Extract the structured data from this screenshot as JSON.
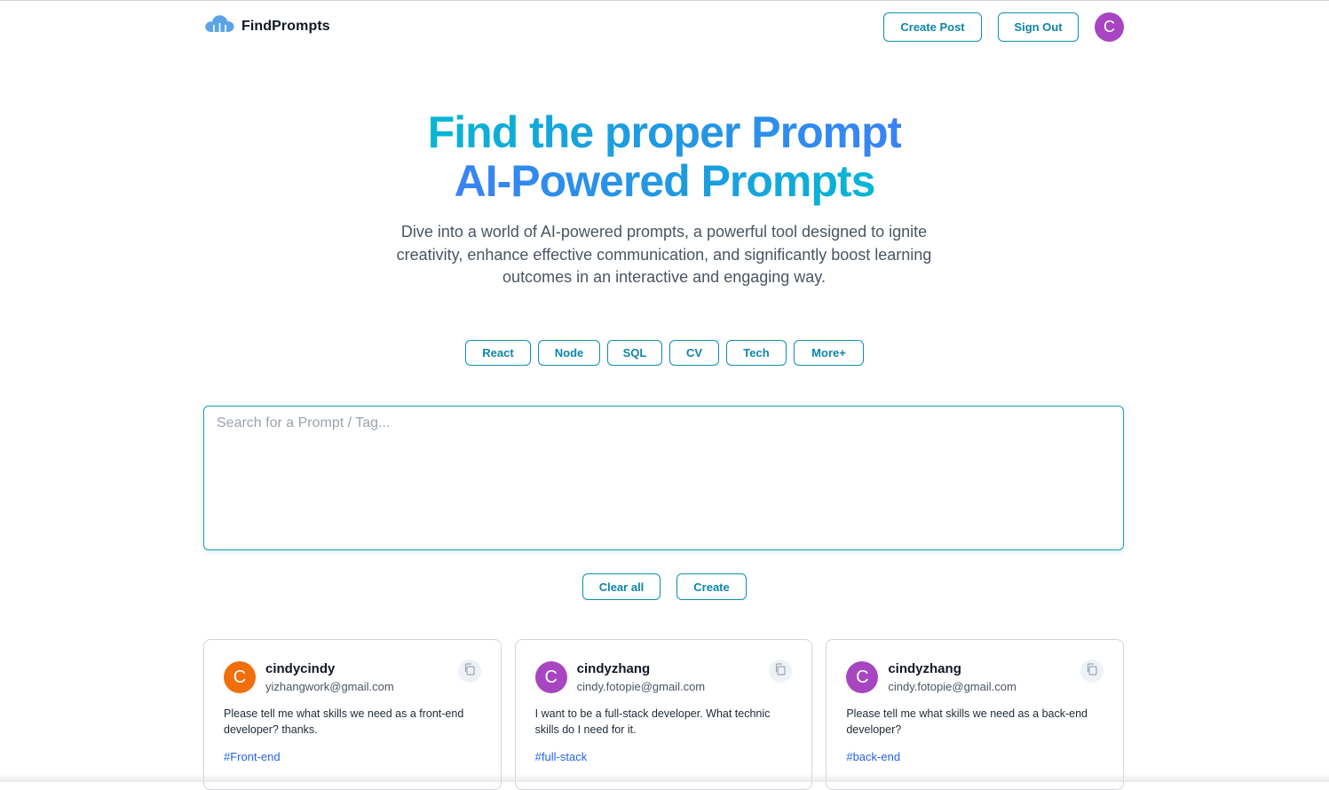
{
  "header": {
    "brand_name": "FindPrompts",
    "logo_icon": "cloud-network-icon",
    "create_post_label": "Create Post",
    "sign_out_label": "Sign Out",
    "avatar_letter": "C",
    "avatar_color": "#a746c0"
  },
  "hero": {
    "title_line1": "Find the proper Prompt",
    "title_line2": "AI-Powered Prompts",
    "description": "Dive into a world of AI-powered prompts, a powerful tool designed to ignite creativity, enhance effective communication, and significantly boost learning outcomes in an interactive and engaging way."
  },
  "tags": [
    {
      "label": "React"
    },
    {
      "label": "Node"
    },
    {
      "label": "SQL"
    },
    {
      "label": "CV"
    },
    {
      "label": "Tech"
    },
    {
      "label": "More+"
    }
  ],
  "search": {
    "placeholder": "Search for a Prompt / Tag...",
    "value": ""
  },
  "actions": {
    "clear_label": "Clear all",
    "create_label": "Create"
  },
  "cards": [
    {
      "avatar_letter": "C",
      "avatar_color": "#f06f0a",
      "username": "cindycindy",
      "email": "yizhangwork@gmail.com",
      "text": "Please tell me what skills we need as a front-end developer? thanks.",
      "tag": "#Front-end",
      "copy_icon": "copy-icon"
    },
    {
      "avatar_letter": "C",
      "avatar_color": "#a746c0",
      "username": "cindyzhang",
      "email": "cindy.fotopie@gmail.com",
      "text": "I want to be a full-stack developer. What technic skills do I need for it.",
      "tag": "#full-stack",
      "copy_icon": "copy-icon"
    },
    {
      "avatar_letter": "C",
      "avatar_color": "#a746c0",
      "username": "cindyzhang",
      "email": "cindy.fotopie@gmail.com",
      "text": "Please tell me what skills we need as a back-end developer?",
      "tag": "#back-end",
      "copy_icon": "copy-icon"
    }
  ],
  "colors": {
    "accent": "#0e86a8",
    "gradient_start": "#06b6d4",
    "gradient_end": "#3b82f6",
    "tag_link": "#2563eb"
  }
}
